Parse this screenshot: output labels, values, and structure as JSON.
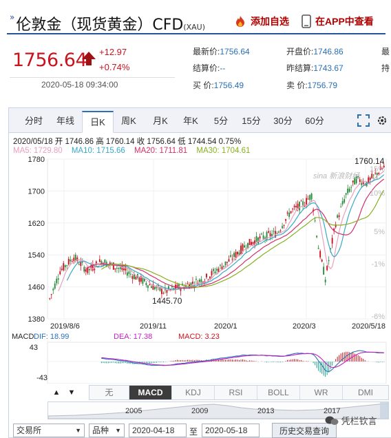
{
  "header": {
    "mark": "»",
    "title": "伦敦金（现货黄金）CFD",
    "subtitle": "(XAU)",
    "add_watch": "添加自选",
    "view_in_app": "在APP中查看"
  },
  "quote": {
    "price": "1756.64",
    "change": "+12.97",
    "change_pct": "+0.74%",
    "timestamp": "2020-05-18 09:34:00",
    "fields": [
      {
        "k": "最新价:",
        "v": "1756.64"
      },
      {
        "k": "结算价:",
        "v": "--"
      },
      {
        "k": "买 价:",
        "v": "1756.49"
      },
      {
        "k": "开盘价:",
        "v": "1746.86"
      },
      {
        "k": "昨结算:",
        "v": "1743.67"
      },
      {
        "k": "卖 价:",
        "v": "1756.79"
      },
      {
        "k": "最",
        "v": ""
      },
      {
        "k": "持",
        "v": ""
      }
    ]
  },
  "tabs": [
    "分时",
    "年线",
    "日K",
    "周K",
    "月K",
    "年K",
    "5分",
    "15分",
    "30分",
    "60分"
  ],
  "active_tab": "日K",
  "info_line": "2020/05/18 开 1746.86 高 1760.14 收 1756.64 低 1744.54 0.75%",
  "ma": [
    {
      "label": "MA5: 1729.80",
      "color": "#e8a0c0"
    },
    {
      "label": "MA10: 1715.66",
      "color": "#38a8c8"
    },
    {
      "label": "MA20: 1711.81",
      "color": "#d0306a"
    },
    {
      "label": "MA30: 1704.61",
      "color": "#88b020"
    }
  ],
  "chart_data": {
    "type": "candlestick",
    "y_ticks": [
      "1780",
      "1700",
      "1620",
      "1540",
      "1460",
      "1380"
    ],
    "ylim": [
      1380,
      1780
    ],
    "pct_ticks": [
      "15%",
      "10%",
      "5%",
      "-1%",
      "-6%"
    ],
    "x_ticks": [
      "2019/8/6",
      "2019/11",
      "2020/1",
      "2020/3",
      "2020/5/18"
    ],
    "annotations": {
      "high": "1760.14",
      "low": "1445.70"
    },
    "watermark": "sina 新浪财经",
    "macd": {
      "label": "MACD",
      "dif": "DIF: 18.99",
      "dea": "DEA: 17.38",
      "macd": "MACD: 3.23",
      "y_ticks": [
        "43",
        "-43"
      ]
    }
  },
  "indicators": [
    "无",
    "MACD",
    "KDJ",
    "RSI",
    "BOLL",
    "WR",
    "DMI"
  ],
  "active_indicator": "MACD",
  "overview_years": [
    "2005",
    "2009",
    "2013",
    "2017"
  ],
  "controls": {
    "exchange": "交易所",
    "product": "品种",
    "start_date": "2020-04-18",
    "to": "至",
    "end_date": "2020-05-18",
    "history_btn": "历史交易查询"
  },
  "brand_watermark": "凭栏钦言",
  "colors": {
    "up": "#c8141e",
    "down": "#2a8a3a",
    "accent": "#2a4f9a",
    "link": "#2a6fb4"
  }
}
